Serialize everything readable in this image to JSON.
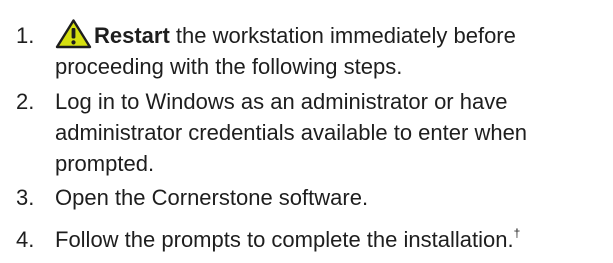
{
  "steps": [
    {
      "number": "1.",
      "warning_icon": "warning-triangle-icon",
      "bold_word": "Restart",
      "line1_rest": " the workstation immediately before",
      "line2": "proceeding with the following steps."
    },
    {
      "number": "2.",
      "line1": "Log in to Windows as an administrator or have",
      "line2": "administrator credentials available to enter when",
      "line3": "prompted."
    },
    {
      "number": "3.",
      "line1": "Open the Cornerstone software."
    },
    {
      "number": "4.",
      "line1": "Follow the prompts to complete the installation.",
      "footnote_mark": "†"
    }
  ],
  "colors": {
    "text": "#1e1e1e",
    "warning_fill": "#d6e010",
    "warning_outline": "#1e1e1e"
  }
}
